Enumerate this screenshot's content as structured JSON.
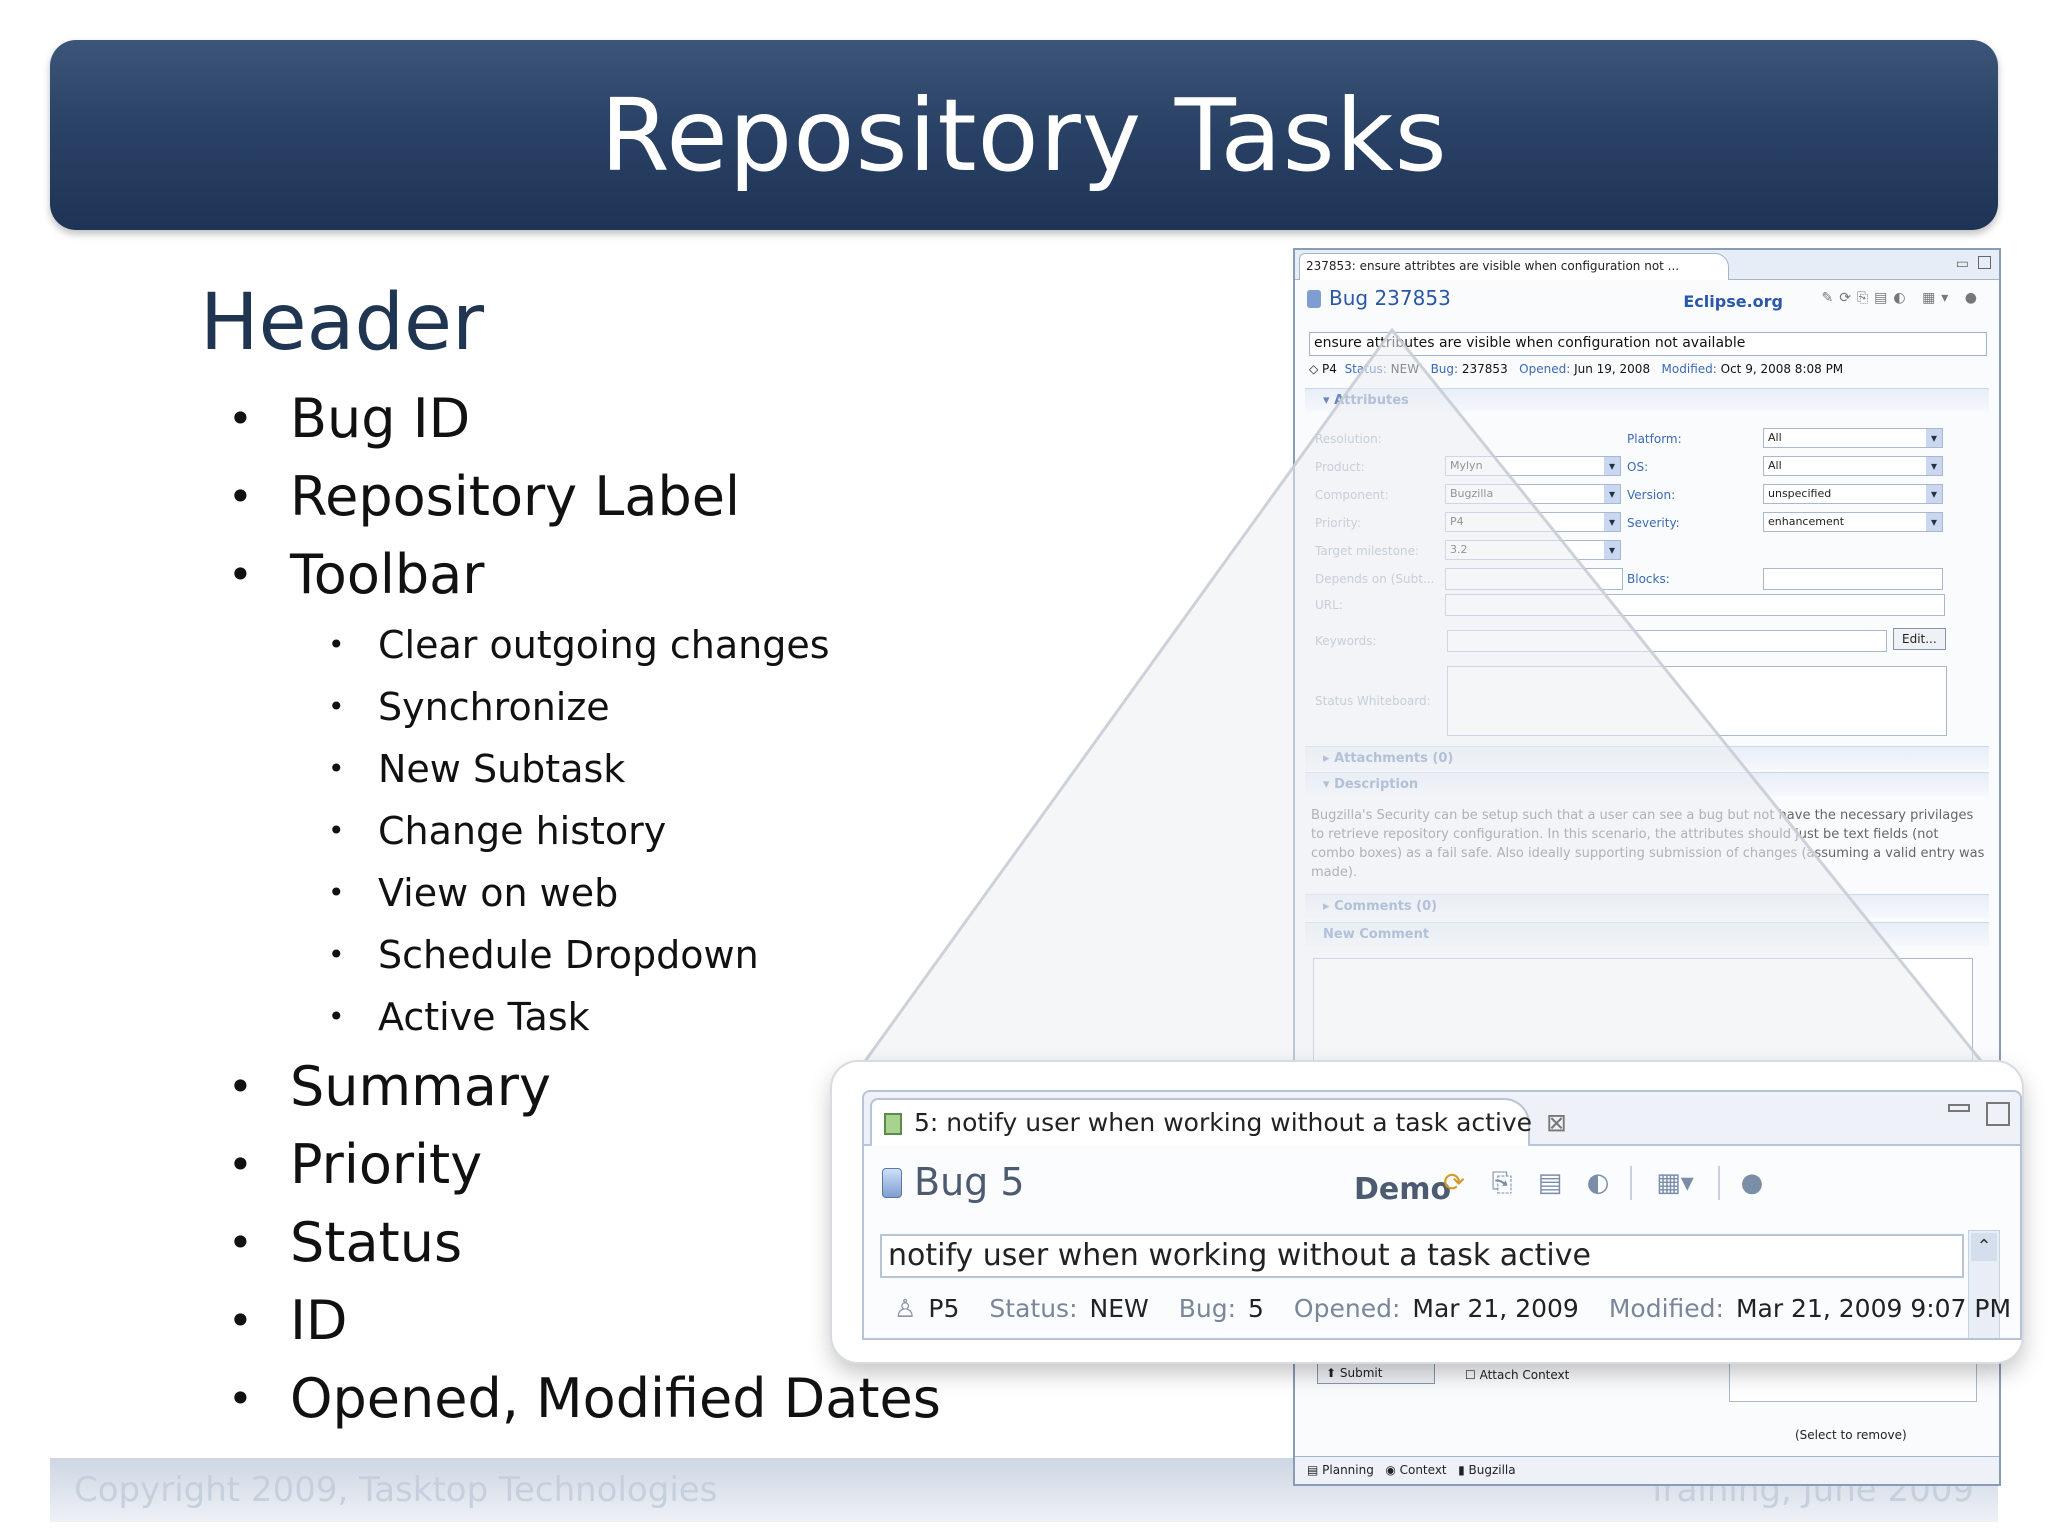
{
  "slide": {
    "title": "Repository Tasks",
    "section_heading": "Header",
    "footer_left": "Copyright 2009, Tasktop Technologies",
    "footer_right": "Training, June 2009",
    "bullets": [
      "Bug ID",
      "Repository Label",
      "Toolbar",
      "Summary",
      "Priority",
      "Status",
      "ID",
      "Opened, Modified Dates"
    ],
    "toolbar_subitems": [
      "Clear outgoing changes",
      "Synchronize",
      "New Subtask",
      "Change history",
      "View on web",
      "Schedule Dropdown",
      "Active Task"
    ]
  },
  "eclipse_editor": {
    "tab_title": "237853: ensure attribtes are visible when configuration not ...",
    "bug_label": "Bug 237853",
    "repository": "Eclipse.org",
    "summary": "ensure attributes are visible when configuration not available",
    "meta": {
      "priority": "P4",
      "status_label": "Status:",
      "status": "NEW",
      "bug_label": "Bug:",
      "bug": "237853",
      "opened_label": "Opened:",
      "opened": "Jun 19, 2008",
      "modified_label": "Modified:",
      "modified": "Oct 9, 2008 8:08 PM"
    },
    "sections": {
      "attributes": "Attributes",
      "attachments": "Attachments (0)",
      "description": "Description",
      "comments": "Comments (0)",
      "new_comment": "New Comment"
    },
    "attributes": {
      "resolution_label": "Resolution:",
      "product_label": "Product:",
      "product": "Mylyn",
      "component_label": "Component:",
      "component": "Bugzilla",
      "priority_label": "Priority:",
      "priority": "P4",
      "target_label": "Target milestone:",
      "target": "3.2",
      "depends_label": "Depends on (Subt...",
      "url_label": "URL:",
      "keywords_label": "Keywords:",
      "edit_button": "Edit...",
      "whiteboard_label": "Status Whiteboard:",
      "platform_label": "Platform:",
      "platform": "All",
      "os_label": "OS:",
      "os": "All",
      "version_label": "Version:",
      "version": "unspecified",
      "severity_label": "Severity:",
      "severity": "enhancement",
      "blocks_label": "Blocks:"
    },
    "description": "Bugzilla's Security can be setup such that a user can see a bug but not have the necessary privilages to retrieve repository configuration. In this scenario, the attributes should just be text fields (not combo boxes) as a fail safe.  Also ideally supporting submission of changes (assuming a valid entry was made).",
    "submit_button": "Submit",
    "attach_context": "Attach Context",
    "select_to_remove": "(Select to remove)",
    "bottom_tabs": [
      "Planning",
      "Context",
      "Bugzilla"
    ]
  },
  "zoom_callout": {
    "tab_title": "5: notify user when working without a task active",
    "bug_label": "Bug 5",
    "repository": "Demo",
    "summary": "notify user when working without a task active",
    "meta": {
      "priority": "P5",
      "status_label": "Status:",
      "status": "NEW",
      "bug_label": "Bug:",
      "bug": "5",
      "opened_label": "Opened:",
      "opened": "Mar 21, 2009",
      "modified_label": "Modified:",
      "modified": "Mar 21, 2009 9:07 PM"
    }
  }
}
